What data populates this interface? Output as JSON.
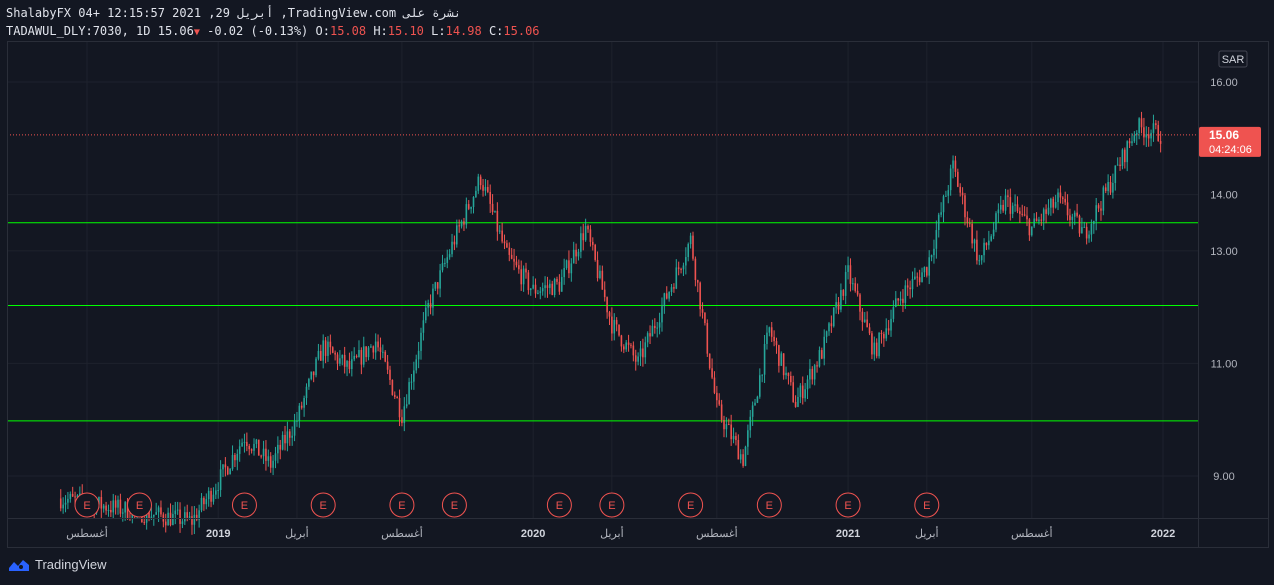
{
  "header": {
    "line1": "ShalabyFX 04+ 12:15:57 2021 ,29 أبريل ,TradingView.com نشرة على",
    "symbol": "TADAWUL_DLY:7030, 1D",
    "last": "15.06",
    "change": "-0.02 (-0.13%)",
    "o_label": "O:",
    "o": "15.08",
    "h_label": "H:",
    "h": "15.10",
    "l_label": "L:",
    "l": "14.98",
    "c_label": "C:",
    "c": "15.06"
  },
  "currency_label": "SAR",
  "footer": {
    "brand": "TradingView"
  },
  "colors": {
    "background": "#131722",
    "grid": "#1e222d",
    "up": "#26a69a",
    "down": "#ef5350",
    "level_line": "#00ff00",
    "price_badge": "#ef5350"
  },
  "chart_data": {
    "type": "candlestick",
    "ylim": [
      8.3,
      16.55
    ],
    "y_ticks": [
      "9.00",
      "11.00",
      "13.00",
      "14.00",
      "16.00"
    ],
    "x_ticks": [
      {
        "label": "أغسطس",
        "date": "2018-08",
        "bold": false
      },
      {
        "label": "2019",
        "date": "2019-01",
        "bold": true
      },
      {
        "label": "أبريل",
        "date": "2019-04",
        "bold": false
      },
      {
        "label": "أغسطس",
        "date": "2019-08",
        "bold": false
      },
      {
        "label": "2020",
        "date": "2020-01",
        "bold": true
      },
      {
        "label": "أبريل",
        "date": "2020-04",
        "bold": false
      },
      {
        "label": "أغسطس",
        "date": "2020-08",
        "bold": false
      },
      {
        "label": "2021",
        "date": "2021-01",
        "bold": true
      },
      {
        "label": "أبريل",
        "date": "2021-04",
        "bold": false
      },
      {
        "label": "أغسطس",
        "date": "2021-08",
        "bold": false
      },
      {
        "label": "2022",
        "date": "2022-01",
        "bold": true
      }
    ],
    "horizontal_levels": [
      {
        "value": 13.5,
        "label": "13.50"
      },
      {
        "value": 12.03,
        "label": "12.03"
      },
      {
        "value": 9.98,
        "label": "9.98"
      }
    ],
    "last_price": {
      "value": 15.06,
      "label": "15.06",
      "countdown": "04:24:06"
    },
    "earnings_marker_label": "E",
    "earnings_dates": [
      "2018-08",
      "2018-10",
      "2019-02",
      "2019-05",
      "2019-08",
      "2019-10",
      "2020-02",
      "2020-04",
      "2020-07",
      "2020-10",
      "2021-01",
      "2021-04"
    ],
    "price_path": [
      [
        "2018-07",
        8.6
      ],
      [
        "2018-12",
        8.2
      ],
      [
        "2019-01",
        8.9
      ],
      [
        "2019-02",
        9.7
      ],
      [
        "2019-03",
        9.2
      ],
      [
        "2019-04",
        10.0
      ],
      [
        "2019-05",
        11.3
      ],
      [
        "2019-06",
        10.9
      ],
      [
        "2019-07",
        11.4
      ],
      [
        "2019-08",
        10.1
      ],
      [
        "2019-09",
        12.0
      ],
      [
        "2019-10",
        13.2
      ],
      [
        "2019-11",
        14.3
      ],
      [
        "2019-12",
        12.9
      ],
      [
        "2020-01",
        12.3
      ],
      [
        "2020-02",
        12.4
      ],
      [
        "2020-03",
        13.4
      ],
      [
        "2020-04",
        11.7
      ],
      [
        "2020-05",
        11.0
      ],
      [
        "2020-06",
        12.1
      ],
      [
        "2020-07",
        13.2
      ],
      [
        "2020-08",
        10.2
      ],
      [
        "2020-09",
        9.3
      ],
      [
        "2020-10",
        11.6
      ],
      [
        "2020-11",
        10.3
      ],
      [
        "2020-12",
        11.2
      ],
      [
        "2021-01",
        12.6
      ],
      [
        "2021-02",
        11.2
      ],
      [
        "2021-03",
        12.2
      ],
      [
        "2021-04",
        12.7
      ],
      [
        "2021-05",
        14.5
      ],
      [
        "2021-06",
        12.8
      ],
      [
        "2021-07",
        13.9
      ],
      [
        "2021-08",
        13.4
      ],
      [
        "2021-09",
        13.9
      ],
      [
        "2021-10",
        13.3
      ],
      [
        "2021-11",
        14.2
      ],
      [
        "2021-12",
        15.2
      ],
      [
        "2022-01",
        15.06
      ]
    ]
  }
}
